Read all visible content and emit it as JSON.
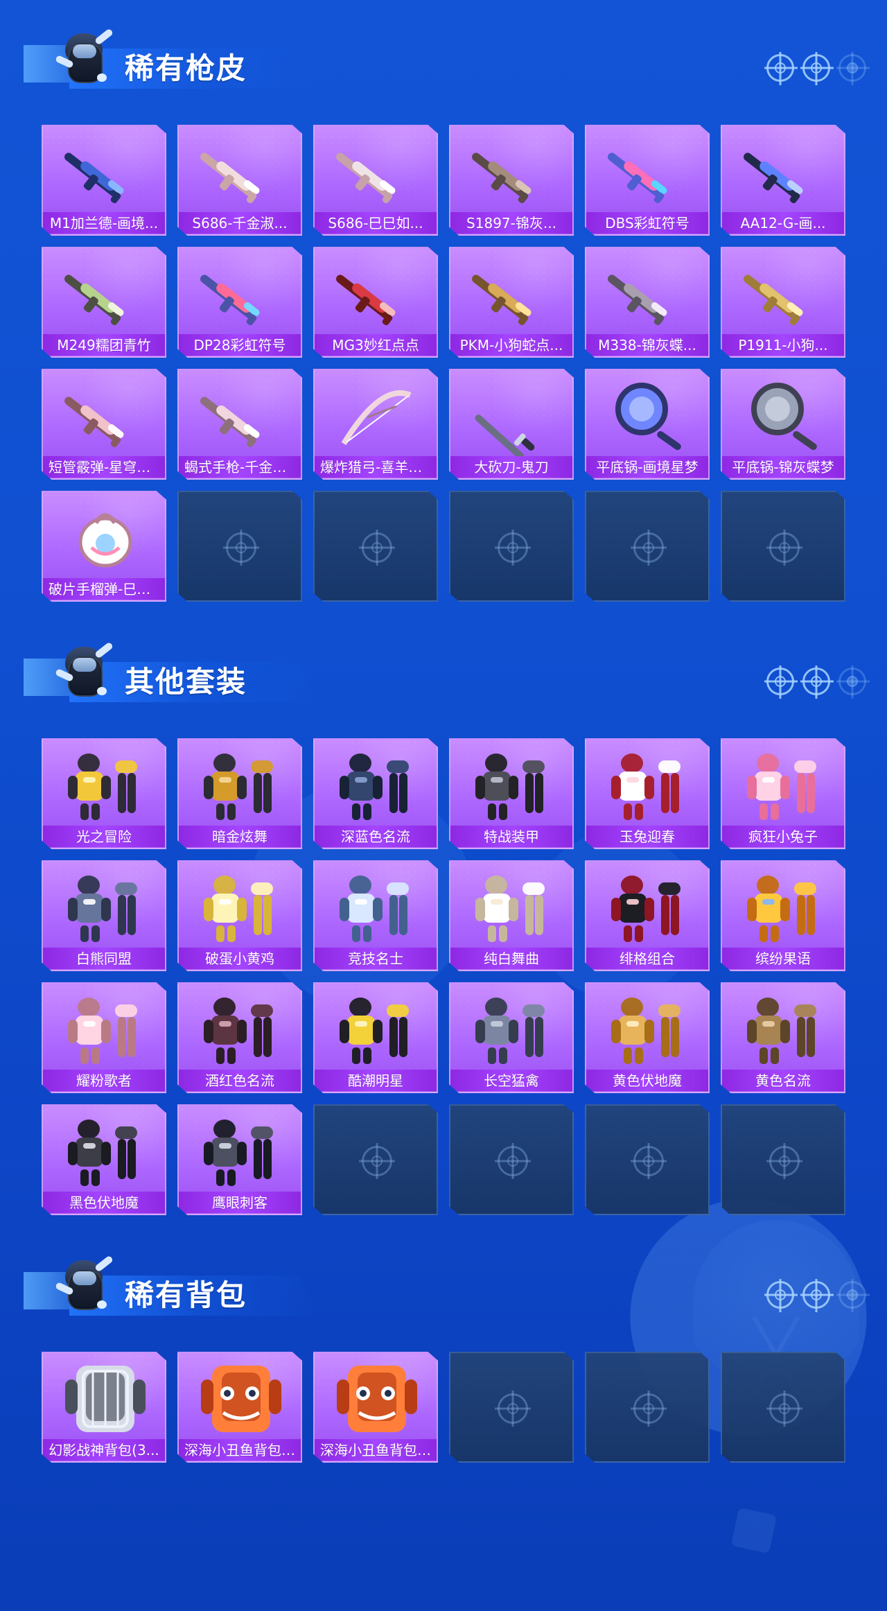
{
  "sections": [
    {
      "title": "稀有枪皮",
      "items": [
        {
          "label": "M1加兰德-画境...",
          "art": "rifle-blue"
        },
        {
          "label": "S686-千金淑...",
          "art": "shotgun-light"
        },
        {
          "label": "S686-巳巳如...",
          "art": "shotgun-pink"
        },
        {
          "label": "S1897-锦灰...",
          "art": "shotgun-dark"
        },
        {
          "label": "DBS彩虹符号",
          "art": "smg-rainbow"
        },
        {
          "label": "AA12-G-画...",
          "art": "smg-blue"
        },
        {
          "label": "M249糯团青竹",
          "art": "lmg-green"
        },
        {
          "label": "DP28彩虹符号",
          "art": "lmg-rainbow"
        },
        {
          "label": "MG3妙红点点",
          "art": "lmg-red"
        },
        {
          "label": "PKM-小狗蛇点...",
          "art": "lmg-gold"
        },
        {
          "label": "M338-锦灰蝶...",
          "art": "rifle-gray"
        },
        {
          "label": "P1911-小狗...",
          "art": "pistol-gold"
        },
        {
          "label": "短管霰弹-星穹味...",
          "art": "shotgun-star"
        },
        {
          "label": "蝎式手枪-千金淑...",
          "art": "smg-pink"
        },
        {
          "label": "爆炸猎弓-喜羊羊...",
          "art": "bow-pink"
        },
        {
          "label": "大砍刀-鬼刀",
          "art": "machete"
        },
        {
          "label": "平底锅-画境星梦",
          "art": "pan-blue"
        },
        {
          "label": "平底锅-锦灰蝶梦",
          "art": "pan-gray"
        },
        {
          "label": "破片手榴弹-巳巳...",
          "art": "grenade"
        }
      ],
      "empty_count": 5
    },
    {
      "title": "其他套装",
      "items": [
        {
          "label": "光之冒险",
          "art": "suit-yellow"
        },
        {
          "label": "暗金炫舞",
          "art": "suit-black-gold"
        },
        {
          "label": "深蓝色名流",
          "art": "suit-navy"
        },
        {
          "label": "特战装甲",
          "art": "suit-tactical"
        },
        {
          "label": "玉兔迎春",
          "art": "suit-red-white"
        },
        {
          "label": "疯狂小兔子",
          "art": "suit-pink-rabbit"
        },
        {
          "label": "白熊同盟",
          "art": "suit-bear"
        },
        {
          "label": "破蛋小黄鸡",
          "art": "suit-chick"
        },
        {
          "label": "竞技名士",
          "art": "suit-blue-white"
        },
        {
          "label": "纯白舞曲",
          "art": "suit-white"
        },
        {
          "label": "绯格组合",
          "art": "suit-red-black"
        },
        {
          "label": "缤纷果语",
          "art": "suit-orange"
        },
        {
          "label": "耀粉歌者",
          "art": "suit-pink"
        },
        {
          "label": "酒红色名流",
          "art": "suit-wine"
        },
        {
          "label": "酷潮明星",
          "art": "suit-yellow-black"
        },
        {
          "label": "长空猛禽",
          "art": "suit-camo"
        },
        {
          "label": "黄色伏地魔",
          "art": "suit-yellow-hood"
        },
        {
          "label": "黄色名流",
          "art": "suit-brown"
        },
        {
          "label": "黑色伏地魔",
          "art": "suit-black-hood"
        },
        {
          "label": "鹰眼刺客",
          "art": "suit-black-assassin"
        }
      ],
      "empty_count": 4
    },
    {
      "title": "稀有背包",
      "items": [
        {
          "label": "幻影战神背包(3...",
          "art": "backpack-silver"
        },
        {
          "label": "深海小丑鱼背包(...",
          "art": "backpack-fish"
        },
        {
          "label": "深海小丑鱼背包(...",
          "art": "backpack-fish2"
        }
      ],
      "empty_count": 3
    }
  ]
}
